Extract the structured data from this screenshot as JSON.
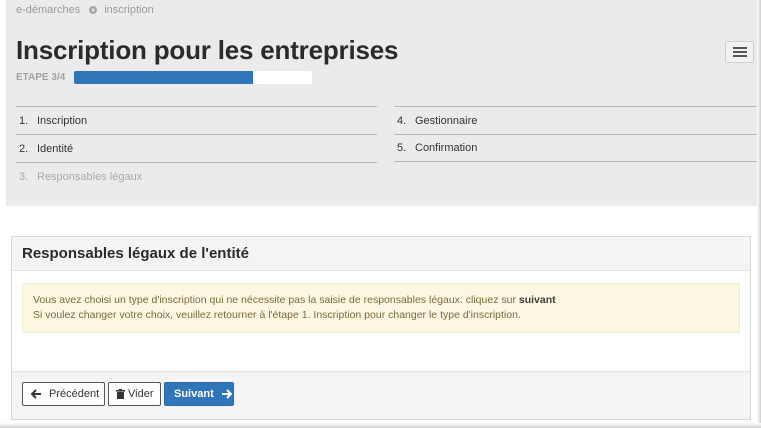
{
  "breadcrumb": {
    "home": "e-démarches",
    "current": "inscription"
  },
  "page": {
    "title": "Inscription pour les entreprises"
  },
  "progress": {
    "label": "ETAPE 3/4",
    "value": 0.75
  },
  "steps": {
    "left": [
      {
        "num": "1.",
        "label": "Inscription"
      },
      {
        "num": "2.",
        "label": "Identité"
      },
      {
        "num": "3.",
        "label": "Responsables légaux"
      }
    ],
    "right": [
      {
        "num": "4.",
        "label": "Gestionnaire"
      },
      {
        "num": "5.",
        "label": "Confirmation"
      }
    ]
  },
  "panel": {
    "title": "Responsables légaux de l'entité",
    "alert_line1": "Vous avez choisi un type d'inscription qui ne nécessite pas la saisie de responsables légaux. cliquez sur",
    "alert_line1_bold": "suivant",
    "alert_line2": "Si voulez changer votre choix, veuillez retourner à l'étape 1. Inscription pour changer le type d'inscription."
  },
  "buttons": {
    "previous": "Précédent",
    "clear": "Vider",
    "next": "Suivant"
  },
  "icons": {
    "breadcrumb_sep": "circle-arrow-icon",
    "menu": "hamburger-icon",
    "previous": "arrow-left-icon",
    "clear": "trash-icon",
    "next": "arrow-right-icon"
  },
  "colors": {
    "primary": "#2f75b9",
    "header_bg": "#ebebeb",
    "alert_bg": "#fcf7e1"
  }
}
